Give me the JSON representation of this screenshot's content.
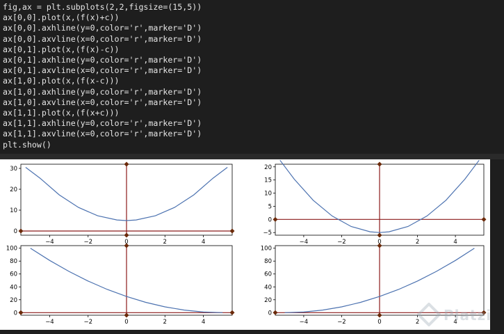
{
  "code_lines": [
    "fig,ax = plt.subplots(2,2,figsize=(15,5))",
    "ax[0,0].plot(x,(f(x)+c))",
    "ax[0,0].axhline(y=0,color='r',marker='D')",
    "ax[0,0].axvline(x=0,color='r',marker='D')",
    "ax[0,1].plot(x,(f(x)-c))",
    "ax[0,1].axhline(y=0,color='r',marker='D')",
    "ax[0,1].axvline(x=0,color='r',marker='D')",
    "ax[1,0].plot(x,(f(x-c)))",
    "ax[1,0].axhline(y=0,color='r',marker='D')",
    "ax[1,0].axvline(x=0,color='r',marker='D')",
    "ax[1,1].plot(x,(f(x+c)))",
    "ax[1,1].axhline(y=0,color='r',marker='D')",
    "ax[1,1].axvline(x=0,color='r',marker='D')",
    "plt.show()"
  ],
  "watermark": {
    "text": "Platzi",
    "icon": "platzi-logo-icon"
  },
  "colors": {
    "line": "#4c72b0",
    "ref_line": "#8b1a1a",
    "marker": "#6b2a0a",
    "axes": "#000000",
    "background": "#1e1e1e"
  },
  "chart_data": [
    {
      "type": "line",
      "position": "top-left",
      "title": "",
      "xlabel": "",
      "ylabel": "",
      "x": [
        -5.25,
        -4.5,
        -3.5,
        -2.5,
        -1.5,
        -0.5,
        0,
        0.5,
        1.5,
        2.5,
        3.5,
        4.5,
        5.25
      ],
      "series": [
        {
          "values": [
            30.5,
            25.3,
            17.3,
            11.3,
            7.3,
            5.3,
            5.0,
            5.3,
            7.3,
            11.3,
            17.3,
            25.3,
            30.5
          ]
        }
      ],
      "xlim": [
        -5.5,
        5.5
      ],
      "ylim": [
        -2,
        32
      ],
      "xticks": [
        -4,
        -2,
        0,
        2,
        4
      ],
      "yticks": [
        0,
        10,
        20,
        30
      ],
      "xtick_labels": [
        "−4",
        "−2",
        "0",
        "2",
        "4"
      ],
      "ytick_labels": [
        "0",
        "10",
        "20",
        "30"
      ],
      "axhline": 0,
      "axvline": 0,
      "marker": "D"
    },
    {
      "type": "line",
      "position": "top-right",
      "title": "",
      "xlabel": "",
      "ylabel": "",
      "x": [
        -5.25,
        -4.5,
        -3.5,
        -2.5,
        -1.5,
        -0.5,
        0,
        0.5,
        1.5,
        2.5,
        3.5,
        4.5,
        5.25
      ],
      "series": [
        {
          "values": [
            22.5,
            15.3,
            7.3,
            1.3,
            -2.7,
            -4.7,
            -5.0,
            -4.7,
            -2.7,
            1.3,
            7.3,
            15.3,
            22.5
          ]
        }
      ],
      "xlim": [
        -5.5,
        5.5
      ],
      "ylim": [
        -6,
        21
      ],
      "xticks": [
        -4,
        -2,
        0,
        2,
        4
      ],
      "yticks": [
        -5,
        0,
        5,
        10,
        15,
        20
      ],
      "xtick_labels": [
        "−4",
        "−2",
        "0",
        "2",
        "4"
      ],
      "ytick_labels": [
        "−5",
        "0",
        "5",
        "10",
        "15",
        "20"
      ],
      "axhline": 0,
      "axvline": 0,
      "marker": "D"
    },
    {
      "type": "line",
      "position": "bottom-left",
      "title": "",
      "xlabel": "",
      "ylabel": "",
      "x": [
        -5,
        -4,
        -3,
        -2,
        -1,
        0,
        1,
        2,
        3,
        4,
        5
      ],
      "series": [
        {
          "values": [
            100,
            81,
            64,
            49,
            36,
            25,
            16,
            9,
            4,
            1,
            0
          ]
        }
      ],
      "xlim": [
        -5.5,
        5.5
      ],
      "ylim": [
        -4,
        104
      ],
      "xticks": [
        -4,
        -2,
        0,
        2,
        4
      ],
      "yticks": [
        0,
        20,
        40,
        60,
        80,
        100
      ],
      "xtick_labels": [
        "−4",
        "−2",
        "0",
        "2",
        "4"
      ],
      "ytick_labels": [
        "0",
        "20",
        "40",
        "60",
        "80",
        "100"
      ],
      "axhline": 0,
      "axvline": 0,
      "marker": "D"
    },
    {
      "type": "line",
      "position": "bottom-right",
      "title": "",
      "xlabel": "",
      "ylabel": "",
      "x": [
        -5,
        -4,
        -3,
        -2,
        -1,
        0,
        1,
        2,
        3,
        4,
        5
      ],
      "series": [
        {
          "values": [
            0,
            1,
            4,
            9,
            16,
            25,
            36,
            49,
            64,
            81,
            100
          ]
        }
      ],
      "xlim": [
        -5.5,
        5.5
      ],
      "ylim": [
        -4,
        104
      ],
      "xticks": [
        -4,
        -2,
        0,
        2,
        4
      ],
      "yticks": [
        0,
        20,
        40,
        60,
        80,
        100
      ],
      "xtick_labels": [
        "−4",
        "−2",
        "0",
        "2",
        "4"
      ],
      "ytick_labels": [
        "0",
        "20",
        "40",
        "60",
        "80",
        "100"
      ],
      "axhline": 0,
      "axvline": 0,
      "marker": "D"
    }
  ]
}
